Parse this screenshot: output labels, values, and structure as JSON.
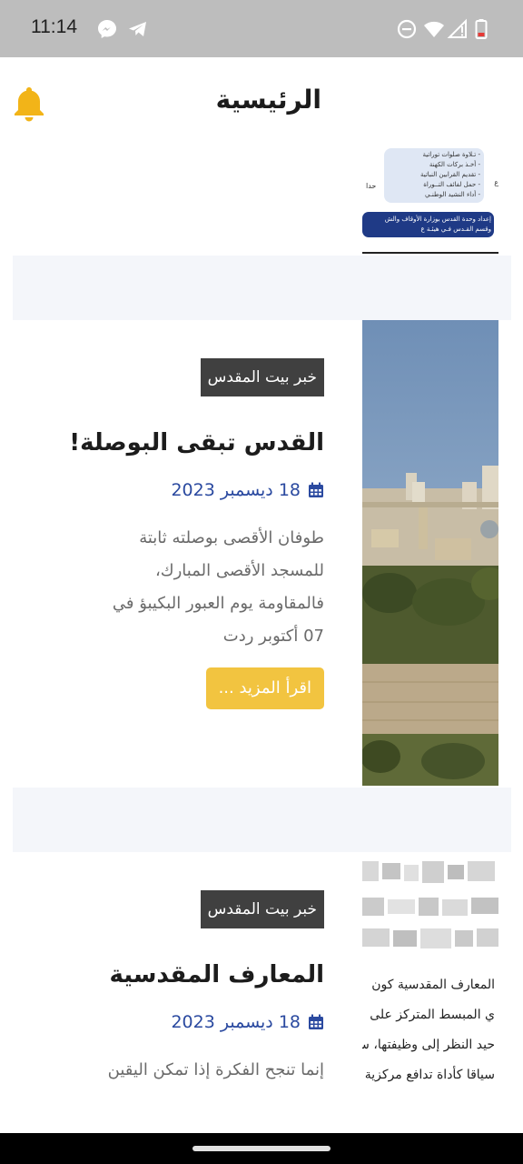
{
  "status_bar": {
    "time": "11:14",
    "icons": [
      "messenger-icon",
      "telegram-icon",
      "do-not-disturb-icon",
      "wifi-icon",
      "signal-icon",
      "battery-icon"
    ]
  },
  "header": {
    "title": "الرئيسية",
    "notification_icon": "bell-icon",
    "bell_color": "#f2b418"
  },
  "partial_image": {
    "lines": [
      "- تـلاوة صلوات توراتية",
      "- أخـذ بركات الكهنة",
      "- تقديم القرابين النباتية",
      "- حمل لفائف التــوراة",
      "- أداء النشيد الوطنـي"
    ],
    "footer_line_1": "إعداد وحدة القدس بوزارة الأوقاف والش",
    "footer_line_2": "وقسم القـدس فـي هيئـة ع"
  },
  "articles": [
    {
      "tag": "خبر بيت المقدس",
      "title": "القدس تبقى البوصلة!",
      "date": "18 ديسمبر 2023",
      "excerpt_lines": [
        "طوفان الأقصى بوصلته ثابتة",
        "للمسجد الأقصى المبارك،",
        "فالمقاومة يوم العبور البكيبؤ في",
        "07 أكتوبر ردت"
      ],
      "read_more": "اقرأ المزيد ..."
    },
    {
      "tag": "خبر بيت المقدس",
      "title": "المعارف المقدسية",
      "date": "18 ديسمبر 2023",
      "excerpt_lines": [
        "إنما تنجح الفكرة إذا تمكن اليقين"
      ],
      "thumb_lines": [
        "المعارف المقدسية كون",
        "ي المبسط المتركز على",
        "حيد النظر إلى وظيفتها، س",
        "سياقا كأداة تدافع مركزية"
      ]
    }
  ],
  "colors": {
    "accent": "#f2c440",
    "tag_bg": "#404040",
    "date": "#2b4aa0"
  }
}
